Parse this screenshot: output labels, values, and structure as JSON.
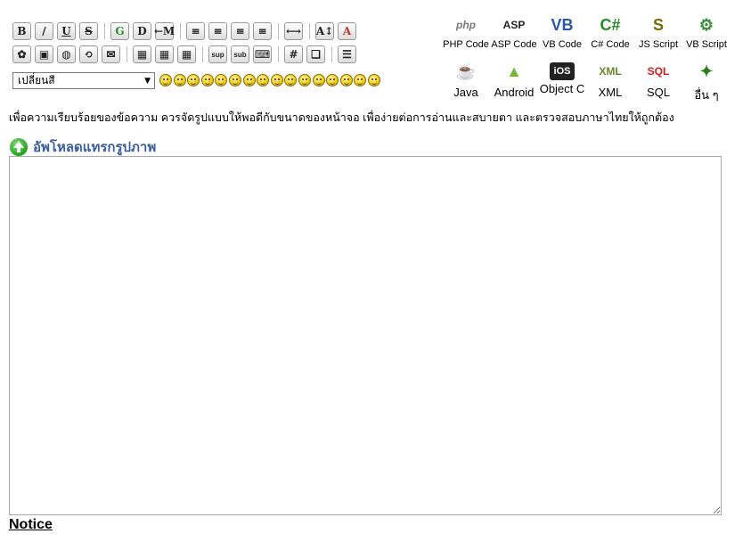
{
  "toolbar": {
    "row1": [
      {
        "name": "bold-button",
        "glyph": "B"
      },
      {
        "name": "italic-button",
        "glyph": "/"
      },
      {
        "name": "underline-button",
        "glyph": "U"
      },
      {
        "name": "strikethrough-button",
        "glyph": "S"
      },
      {
        "sep": true
      },
      {
        "name": "glow-button",
        "glyph": "G"
      },
      {
        "name": "shadow-button",
        "glyph": "D"
      },
      {
        "name": "move-button",
        "glyph": "←M"
      },
      {
        "sep": true
      },
      {
        "name": "align-pre-button",
        "glyph": "≡"
      },
      {
        "name": "align-left-button",
        "glyph": "≡"
      },
      {
        "name": "align-center-button",
        "glyph": "≡"
      },
      {
        "name": "align-right-button",
        "glyph": "≡"
      },
      {
        "sep": true
      },
      {
        "name": "horizontal-rule-button",
        "glyph": "⟷"
      },
      {
        "sep": true
      },
      {
        "name": "font-size-button",
        "glyph": "A↕"
      },
      {
        "name": "font-color-button",
        "glyph": "A"
      }
    ],
    "row2": [
      {
        "name": "flash-button",
        "glyph": "✿"
      },
      {
        "name": "image-button",
        "glyph": "▣"
      },
      {
        "name": "web-link-button",
        "glyph": "◍"
      },
      {
        "name": "ftp-link-button",
        "glyph": "⟲"
      },
      {
        "name": "email-button",
        "glyph": "✉"
      },
      {
        "sep": true
      },
      {
        "name": "table-button",
        "glyph": "▦"
      },
      {
        "name": "table-row-button",
        "glyph": "▦"
      },
      {
        "name": "table-cell-button",
        "glyph": "▦"
      },
      {
        "sep": true
      },
      {
        "name": "superscript-button",
        "glyph": "sup"
      },
      {
        "name": "subscript-button",
        "glyph": "sub"
      },
      {
        "name": "teletype-button",
        "glyph": "⌨"
      },
      {
        "sep": true
      },
      {
        "name": "code-button",
        "glyph": "#"
      },
      {
        "name": "quote-button",
        "glyph": "❏"
      },
      {
        "sep": true
      },
      {
        "name": "list-button",
        "glyph": "☰"
      }
    ]
  },
  "color_select": {
    "selected": "เปลี่ยนสี"
  },
  "emoticon_count": 16,
  "languages": [
    {
      "name": "php-code",
      "label": "PHP Code",
      "icon": "php",
      "color": "#7a7a7a"
    },
    {
      "name": "asp-code",
      "label": "ASP Code",
      "icon": "ASP",
      "color": "#222222"
    },
    {
      "name": "vb-code",
      "label": "VB Code",
      "icon": "VB",
      "color": "#2a57b0"
    },
    {
      "name": "csharp-code",
      "label": "C# Code",
      "icon": "C#",
      "color": "#2b8a2b"
    },
    {
      "name": "js-script",
      "label": "JS Script",
      "icon": "S",
      "color": "#7a6a00"
    },
    {
      "name": "vb-script",
      "label": "VB Script",
      "icon": "⚙",
      "color": "#3a8f3a"
    },
    {
      "name": "java",
      "label": "Java",
      "icon": "☕",
      "color": "#c0392b"
    },
    {
      "name": "android",
      "label": "Android",
      "icon": "▲",
      "color": "#79b836"
    },
    {
      "name": "objective-c",
      "label": "Object C",
      "icon": "iOS",
      "color": "#222222"
    },
    {
      "name": "xml",
      "label": "XML",
      "icon": "XML",
      "color": "#6a8a2a"
    },
    {
      "name": "sql",
      "label": "SQL",
      "icon": "SQL",
      "color": "#d61d1d"
    },
    {
      "name": "other",
      "label": "อื่น ๆ",
      "icon": "✦",
      "color": "#2f7a1f"
    }
  ],
  "instruction": "เพื่อความเรียบร้อยของข้อความ ควรจัดรูปแบบให้พอดีกับขนาดของหน้าจอ เพื่อง่ายต่อการอ่านและสบายตา และตรวจสอบภาษาไทยให้ถูกต้อง",
  "upload_link": "อัพโหลดแทรกรูปภาพ",
  "message": "",
  "notice": "Notice"
}
